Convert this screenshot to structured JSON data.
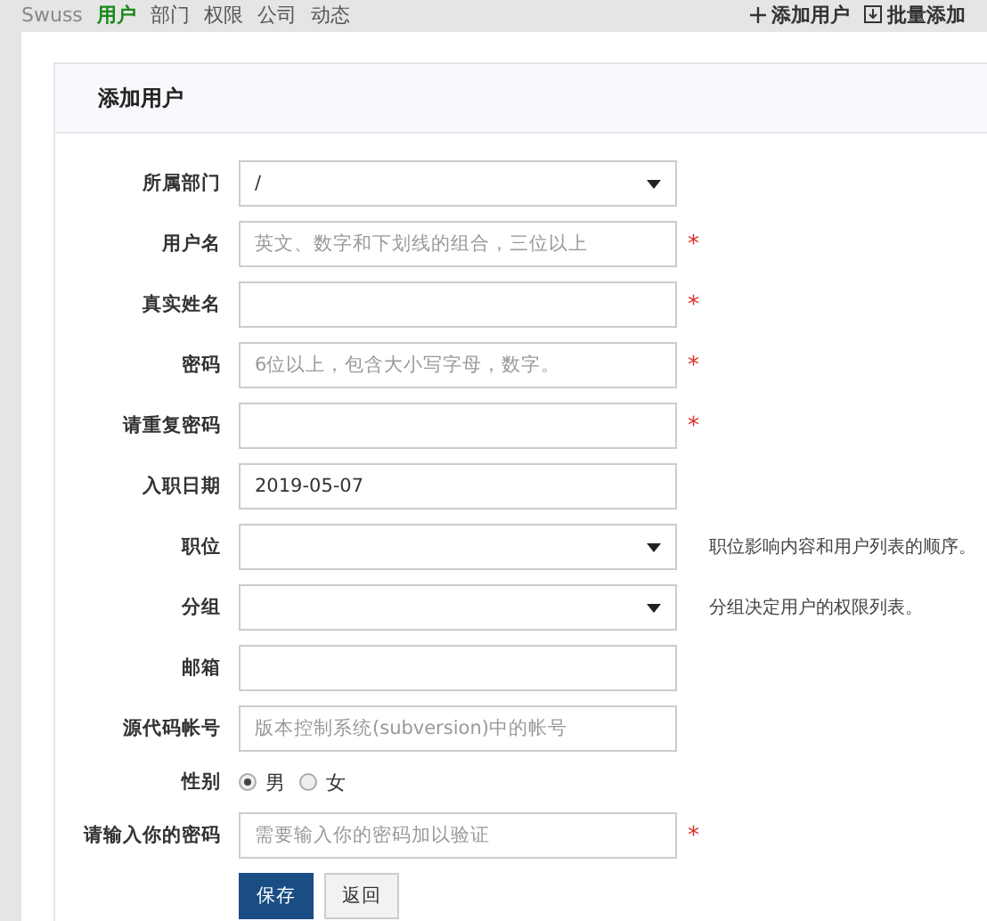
{
  "nav": {
    "brand": "Swuss",
    "items": [
      {
        "label": "用户",
        "selected": true
      },
      {
        "label": "部门",
        "selected": false
      },
      {
        "label": "权限",
        "selected": false
      },
      {
        "label": "公司",
        "selected": false
      },
      {
        "label": "动态",
        "selected": false
      }
    ],
    "actions": [
      {
        "kind": "add",
        "label": "添加用户"
      },
      {
        "kind": "batch",
        "label": "批量添加"
      }
    ]
  },
  "form": {
    "title": "添加用户",
    "fields": [
      {
        "label": "所属部门",
        "kind": "select",
        "value": "/"
      },
      {
        "label": "用户名",
        "kind": "input",
        "placeholder": "英文、数字和下划线的组合，三位以上",
        "required_mark": "*"
      },
      {
        "label": "真实姓名",
        "kind": "input",
        "required_mark": "*"
      },
      {
        "label": "密码",
        "kind": "input",
        "placeholder": "6位以上，包含大小写字母，数字。",
        "required_mark": "*"
      },
      {
        "label": "请重复密码",
        "kind": "input",
        "required_mark": "*"
      },
      {
        "label": "入职日期",
        "kind": "input",
        "value": "2019-05-07"
      },
      {
        "label": "职位",
        "kind": "select",
        "help": "职位影响内容和用户列表的顺序。"
      },
      {
        "label": "分组",
        "kind": "select",
        "help": "分组决定用户的权限列表。"
      },
      {
        "label": "邮箱",
        "kind": "input"
      },
      {
        "label": "源代码帐号",
        "kind": "input",
        "placeholder": "版本控制系统(subversion)中的帐号"
      },
      {
        "label": "性别",
        "kind": "radio",
        "options": [
          {
            "label": "男",
            "selected": true
          },
          {
            "label": "女",
            "selected": false
          }
        ]
      },
      {
        "label": "请输入你的密码",
        "kind": "input",
        "placeholder": "需要输入你的密码加以验证",
        "required_mark": "*"
      }
    ],
    "buttons": [
      {
        "kind": "primary",
        "label": "保存"
      },
      {
        "kind": "default",
        "label": "返回"
      }
    ]
  }
}
